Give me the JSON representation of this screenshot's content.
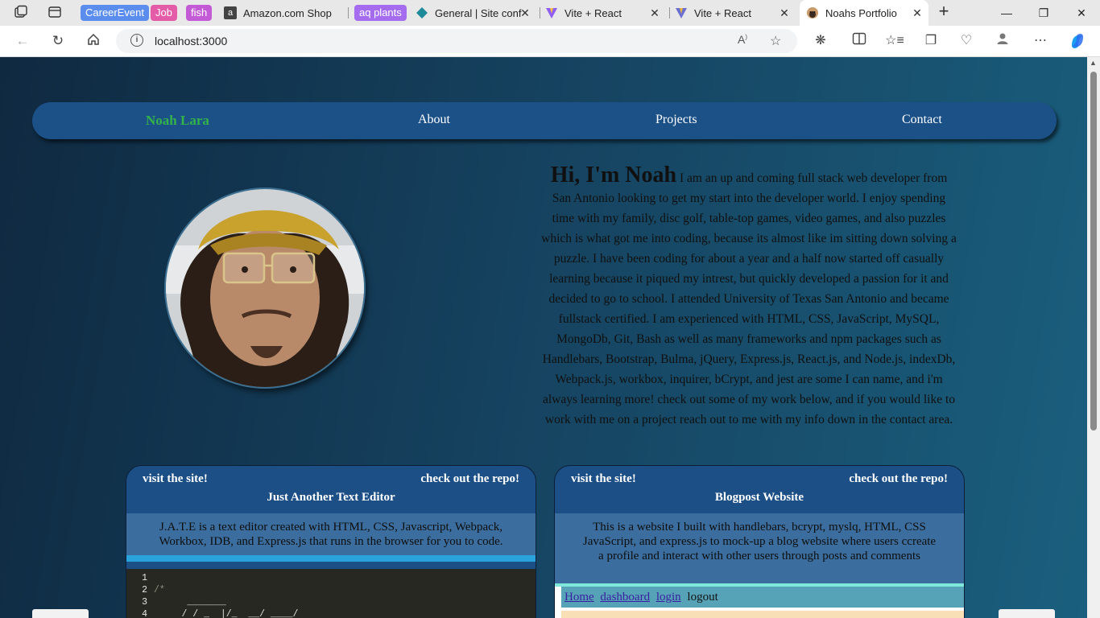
{
  "browser": {
    "tabs": [
      {
        "label": "CareerEvent",
        "type": "group",
        "color": "#5b8def"
      },
      {
        "label": "Job",
        "type": "group",
        "color": "#e45ba7"
      },
      {
        "label": "fish",
        "type": "group",
        "color": "#c45bd6"
      },
      {
        "label": "Amazon.com Shop",
        "type": "tab",
        "icon": "amazon-icon"
      },
      {
        "label": "aq plants",
        "type": "group",
        "color": "#a56cf0"
      },
      {
        "label": "General | Site conf",
        "type": "tab",
        "icon": "diamond-icon"
      },
      {
        "label": "Vite + React",
        "type": "tab",
        "icon": "vite-icon"
      },
      {
        "label": "Vite + React",
        "type": "tab",
        "icon": "vite-icon"
      },
      {
        "label": "Noahs Portfolio",
        "type": "tab",
        "icon": "pug-icon",
        "active": true
      }
    ],
    "new_tab": "+",
    "window_controls": {
      "minimize": "—",
      "restore": "❐",
      "close": "✕"
    },
    "url": "localhost:3000"
  },
  "page": {
    "nav": {
      "brand": "Noah Lara",
      "items": [
        "About",
        "Projects",
        "Contact"
      ]
    },
    "bio": {
      "heading": "Hi, I'm Noah",
      "text": "I am an up and coming full stack web developer from San Antonio looking to get my start into the developer world. I enjoy spending time with my family, disc golf, table-top games, video games, and also puzzles which is what got me into coding, because its almost like im sitting down solving a puzzle. I have been coding for about a year and a half now started off casually learning because it piqued my intrest, but quickly developed a passion for it and decided to go to school. I attended University of Texas San Antonio and became fullstack certified. I am experienced with HTML, CSS, JavaScript, MySQL, MongoDb, Git, Bash as well as many frameworks and npm packages such as Handlebars, Bootstrap, Bulma, jQuery, Express.js, React.js, and Node.js, indexDb, Webpack.js, workbox, inquirer, bCrypt, and jest are some I can name, and i'm always learning more! check out some of my work below, and if you would like to work with me on a project reach out to me with my info down in the contact area."
    },
    "projects": [
      {
        "site_link": "visit the site!",
        "repo_link": "check out the repo!",
        "title": "Just Another Text Editor",
        "description": "J.A.T.E is a text editor created with HTML, CSS, Javascript, Webpack, Workbox, IDB, and Express.js that runs in the browser for you to code.",
        "editor_lines": [
          {
            "num": "1",
            "code": ""
          },
          {
            "num": "2",
            "code": "/*"
          },
          {
            "num": "3",
            "code": "      _______"
          },
          {
            "num": "4",
            "code": "     / / _  |/_  __/ ____/"
          }
        ]
      },
      {
        "site_link": "visit the site!",
        "repo_link": "check out the repo!",
        "title": "Blogpost Website",
        "description": "This is a website I built with handlebars, bcrypt, myslq, HTML, CSS JavaScript, and express.js to mock-up a blog website where users ccreate a profile and interact with other users through posts and comments",
        "preview_nav": {
          "home": "Home",
          "dashboard": "dashboard",
          "login": "login",
          "logout": "logout"
        }
      }
    ]
  }
}
